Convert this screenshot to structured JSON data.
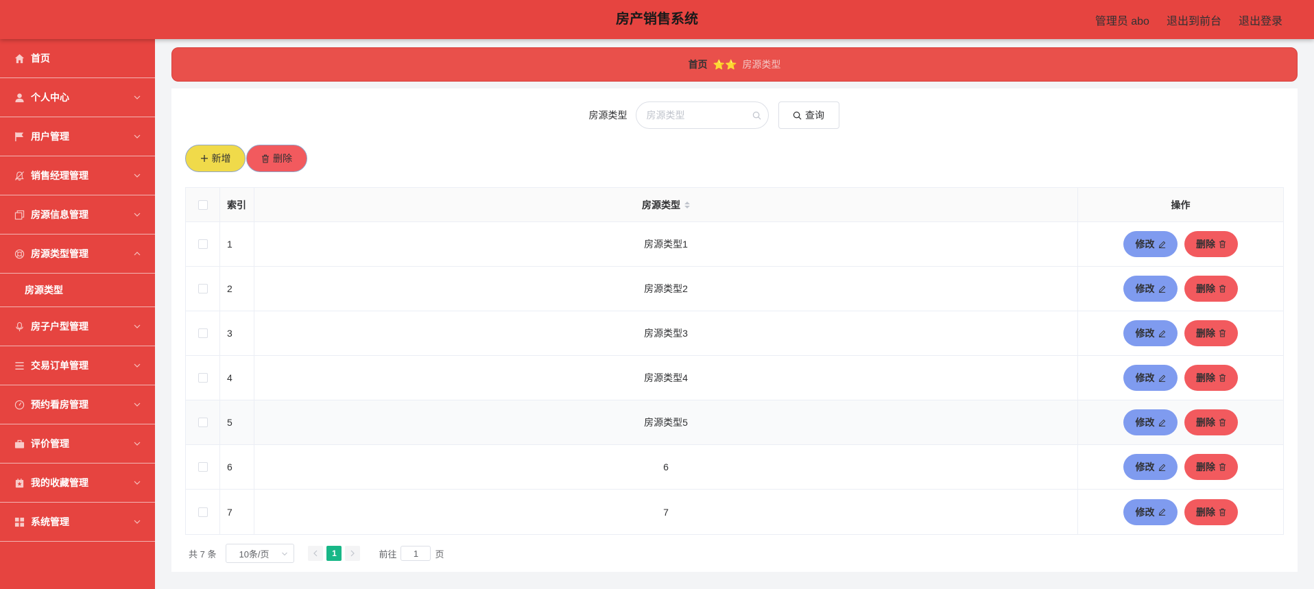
{
  "header": {
    "title": "房产销售系统",
    "user": "管理员 abo",
    "to_front": "退出到前台",
    "logout": "退出登录"
  },
  "sidebar": {
    "items": [
      {
        "label": "首页",
        "icon": "home-icon"
      },
      {
        "label": "个人中心",
        "icon": "user-icon"
      },
      {
        "label": "用户管理",
        "icon": "flag-icon"
      },
      {
        "label": "销售经理管理",
        "icon": "bell-icon"
      },
      {
        "label": "房源信息管理",
        "icon": "copy-icon"
      },
      {
        "label": "房源类型管理",
        "icon": "help-icon",
        "expanded": true,
        "children": [
          {
            "label": "房源类型"
          }
        ]
      },
      {
        "label": "房子户型管理",
        "icon": "microphone-icon"
      },
      {
        "label": "交易订单管理",
        "icon": "list-icon"
      },
      {
        "label": "预约看房管理",
        "icon": "clock-icon"
      },
      {
        "label": "评价管理",
        "icon": "briefcase-icon"
      },
      {
        "label": "我的收藏管理",
        "icon": "star-box-icon"
      },
      {
        "label": "系统管理",
        "icon": "grid-icon"
      }
    ]
  },
  "breadcrumb": {
    "home": "首页",
    "separator": "⭐⭐",
    "current": "房源类型"
  },
  "search": {
    "label": "房源类型",
    "placeholder": "房源类型",
    "value": "",
    "query_label": "查询"
  },
  "actions": {
    "add_label": "新增",
    "delete_label": "删除"
  },
  "table": {
    "columns": {
      "index": "索引",
      "type": "房源类型",
      "ops": "操作"
    },
    "edit_label": "修改",
    "delete_label": "删除",
    "rows": [
      {
        "index": "1",
        "type": "房源类型1"
      },
      {
        "index": "2",
        "type": "房源类型2"
      },
      {
        "index": "3",
        "type": "房源类型3"
      },
      {
        "index": "4",
        "type": "房源类型4"
      },
      {
        "index": "5",
        "type": "房源类型5"
      },
      {
        "index": "6",
        "type": "6"
      },
      {
        "index": "7",
        "type": "7"
      }
    ]
  },
  "pagination": {
    "total": "共 7 条",
    "page_size": "10条/页",
    "current_page": "1",
    "goto_label": "前往",
    "goto_value": "1",
    "page_suffix": "页"
  },
  "colors": {
    "primary": "#e64440",
    "add": "#f0da4a",
    "delete": "#f25a5e",
    "edit": "#7f9bef",
    "page_active": "#18b787"
  }
}
